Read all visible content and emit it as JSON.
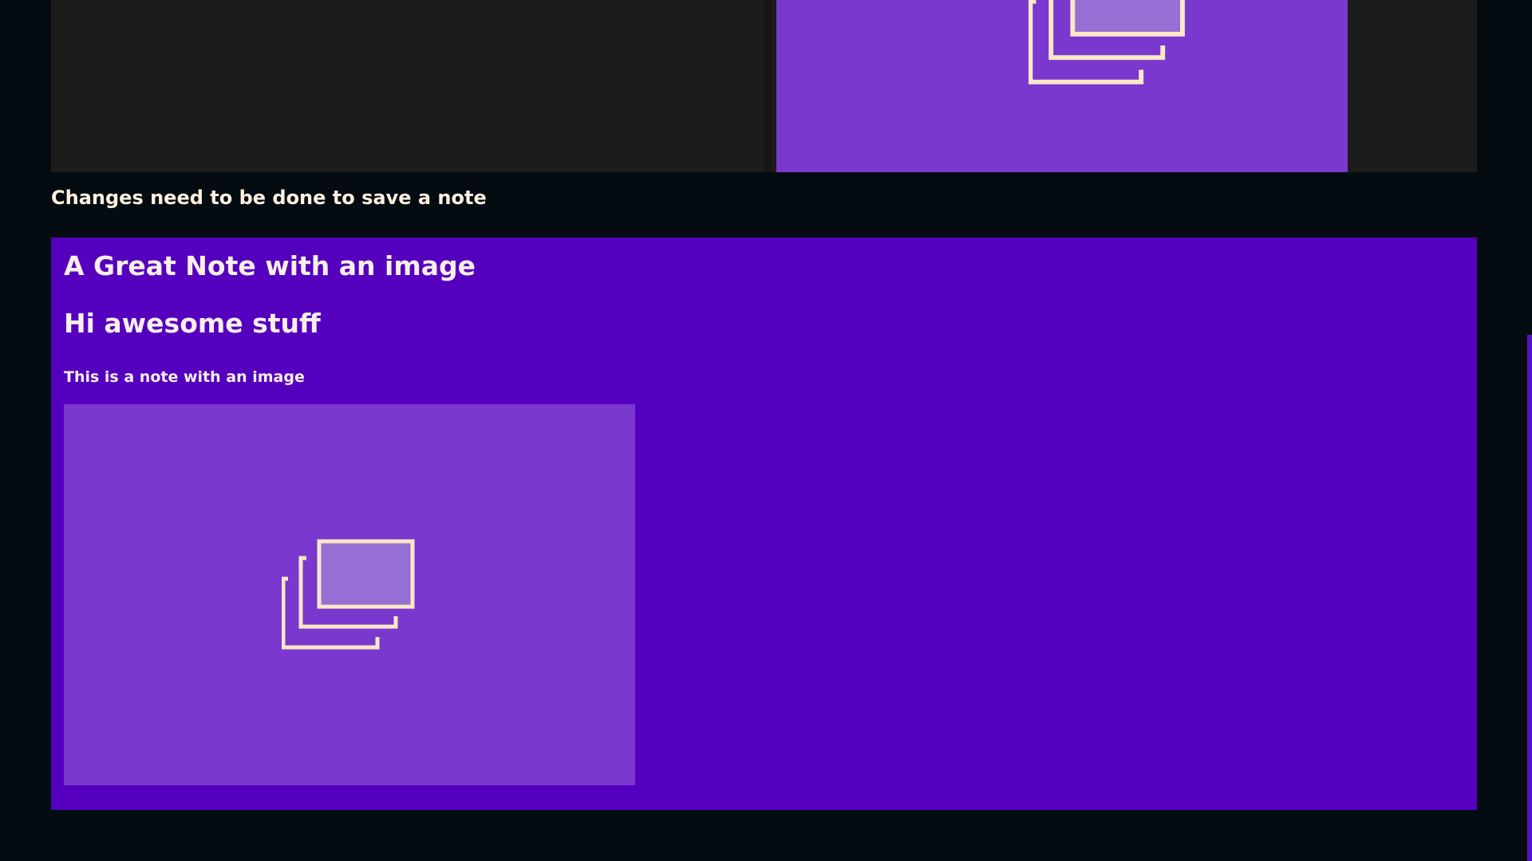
{
  "colors": {
    "page_background": "#050c11",
    "editor_background": "#1c1c1c",
    "note_card_background": "#5500bf",
    "image_placeholder_background": "#7a38cf",
    "placeholder_icon_stroke": "#fbe8c6",
    "placeholder_icon_fill": "#9670d4",
    "accent": "#5a10c4"
  },
  "editor": {
    "image_placeholder_icon": "image-placeholder-icon"
  },
  "status": {
    "message": "Changes need to be done to save a note"
  },
  "note": {
    "title": "A Great Note with an image",
    "heading": "Hi awesome stuff",
    "body": "This is a note with an image",
    "image_placeholder_icon": "image-placeholder-icon"
  }
}
